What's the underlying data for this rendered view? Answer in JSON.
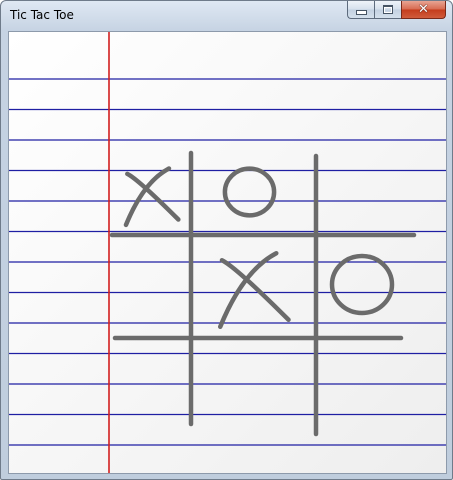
{
  "window": {
    "title": "Tic Tac Toe"
  },
  "caption_buttons": {
    "minimize_icon": "minimize-icon",
    "maximize_icon": "maximize-icon",
    "close_icon": "close-icon"
  },
  "board": {
    "cells": [
      [
        "X",
        "O",
        ""
      ],
      [
        "",
        "X",
        "O"
      ],
      [
        "",
        "",
        ""
      ]
    ]
  },
  "colors": {
    "rule_line": "#1f1fa3",
    "margin_line": "#d21f1f",
    "pencil": "#6b6b6b"
  }
}
